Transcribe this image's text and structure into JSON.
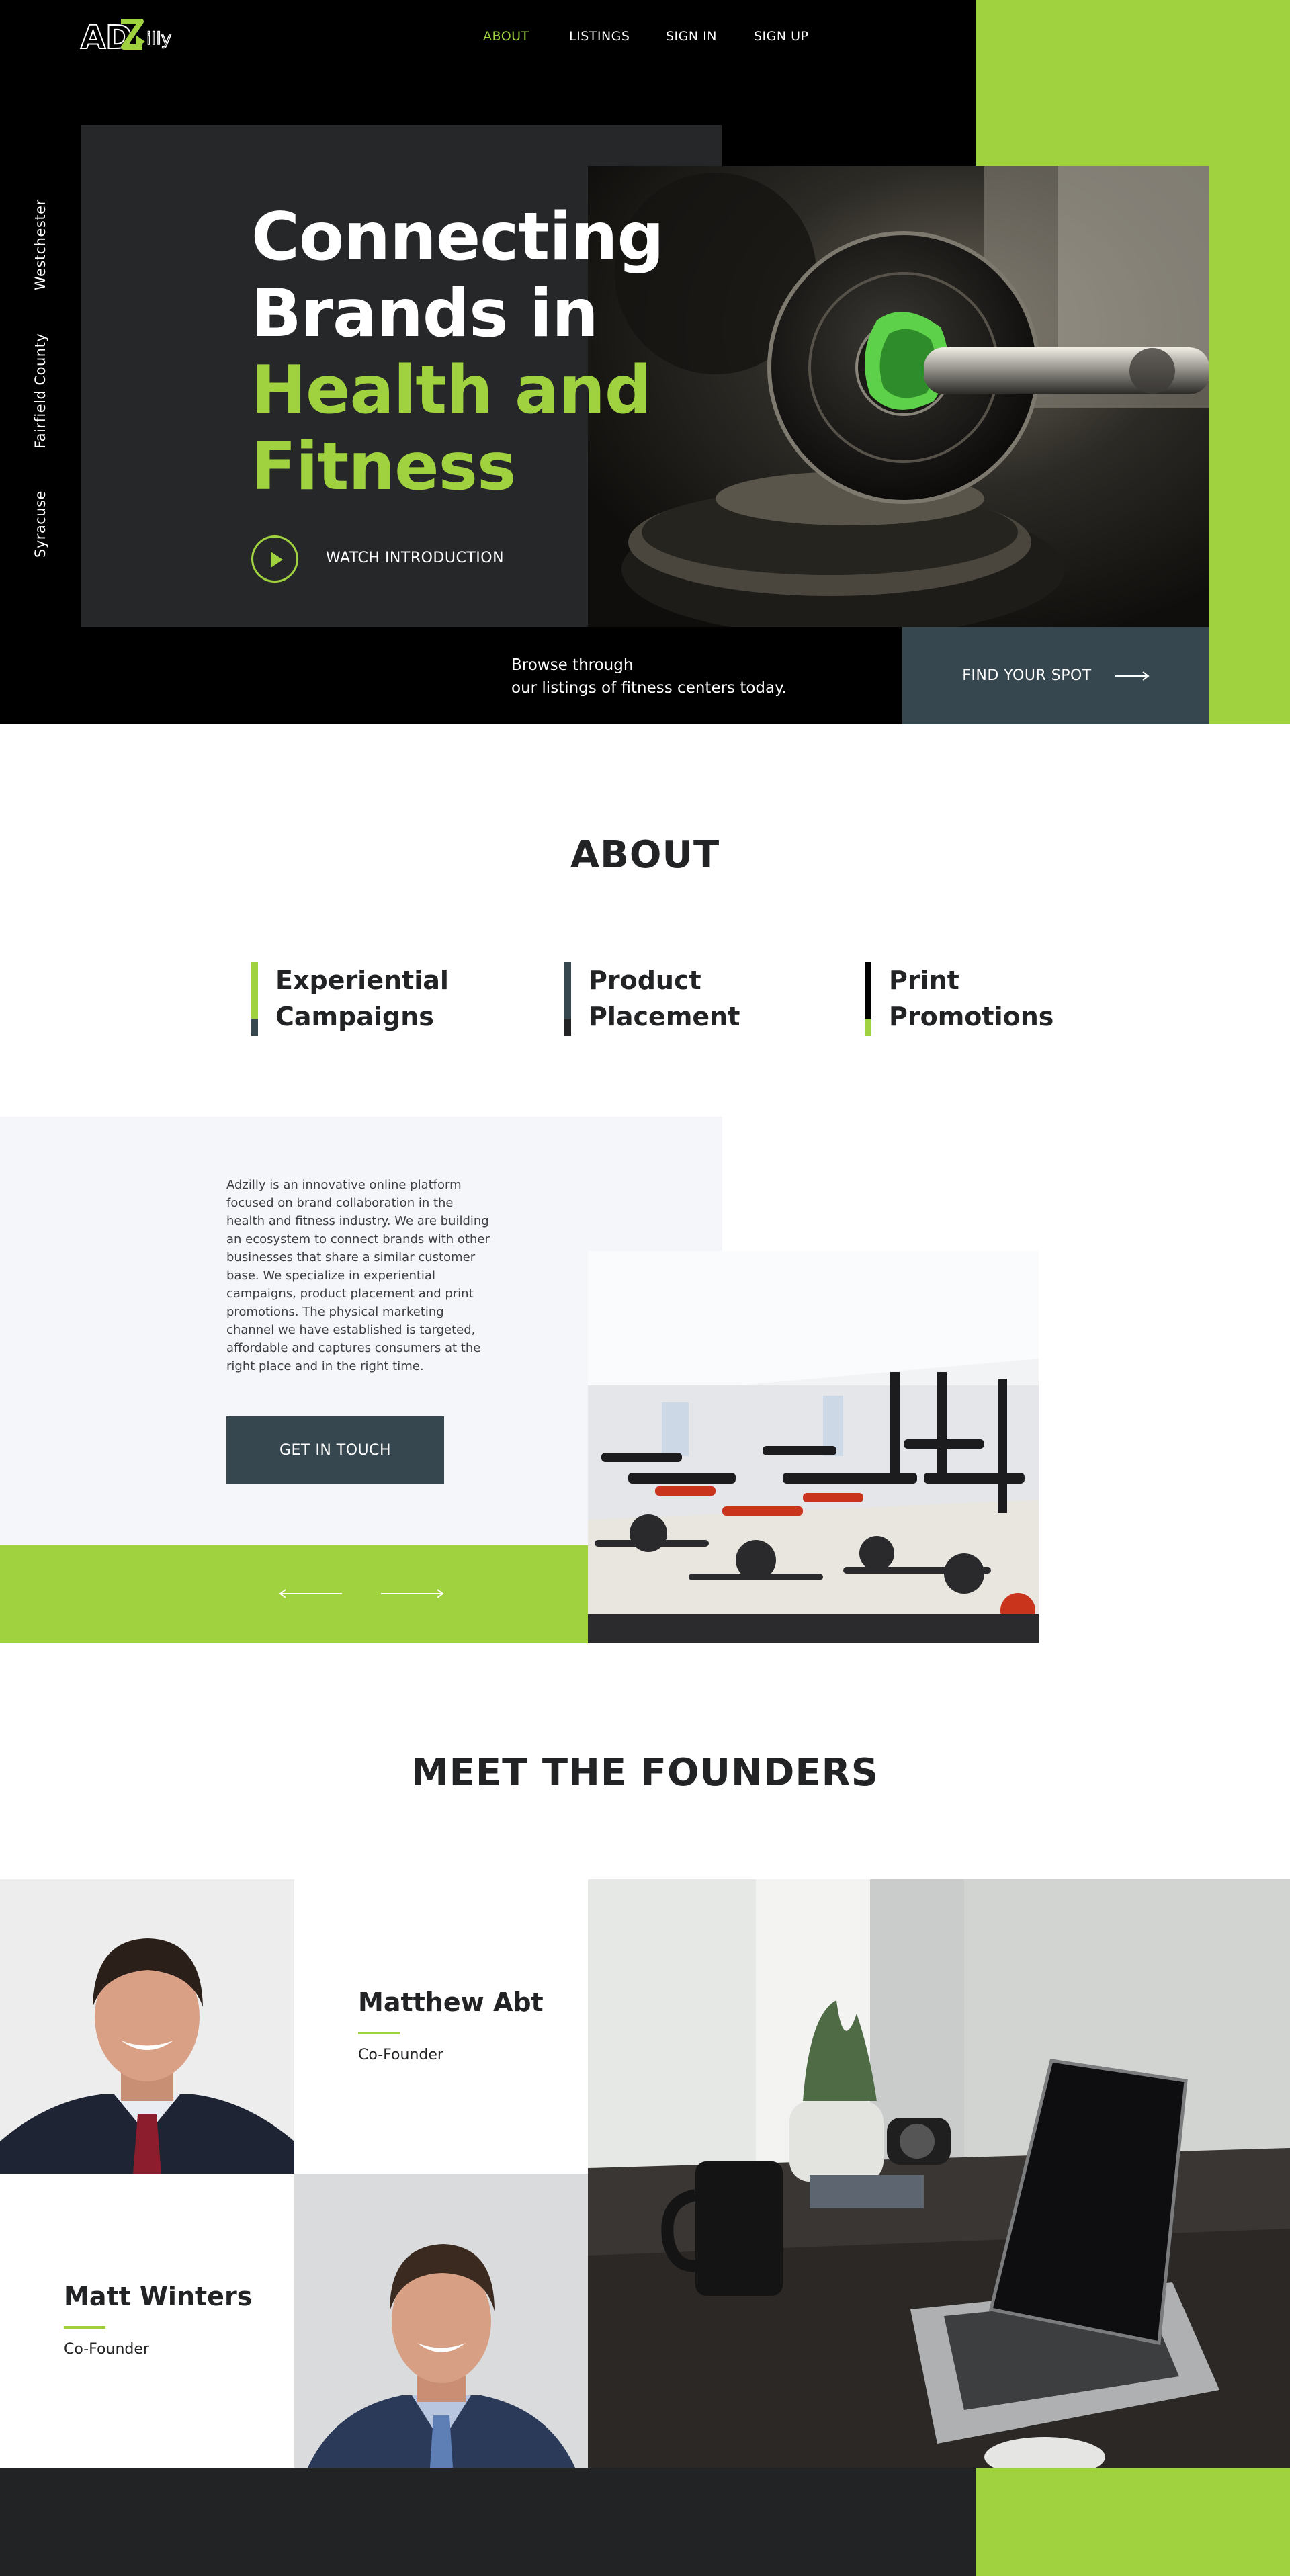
{
  "brand": {
    "logo_text": "ADZilly",
    "colors": {
      "accent": "#a0d23f",
      "dark": "#000000",
      "slate": "#37474f",
      "panel": "#262729",
      "text": "#222325"
    }
  },
  "nav": [
    {
      "label": "ABOUT",
      "active": true
    },
    {
      "label": "LISTINGS",
      "active": false
    },
    {
      "label": "SIGN IN",
      "active": false
    },
    {
      "label": "SIGN UP",
      "active": false
    }
  ],
  "hero": {
    "side_locations": [
      "Westchester",
      "Fairfield County",
      "Syracuse"
    ],
    "headline_white_1": "Connecting",
    "headline_white_2": "Brands in",
    "headline_green_1": "Health and",
    "headline_green_2": "Fitness",
    "watch_label": "WATCH INTRODUCTION",
    "browse_line_1": "Browse through",
    "browse_line_2": "our listings of fitness centers today.",
    "cta_label": "FIND YOUR SPOT",
    "icons": {
      "play": "play-icon",
      "arrow": "arrow-right-icon"
    }
  },
  "about": {
    "title": "ABOUT",
    "services": [
      {
        "line1": "Experiential",
        "line2": "Campaigns"
      },
      {
        "line1": "Product",
        "line2": "Placement"
      },
      {
        "line1": "Print",
        "line2": "Promotions"
      }
    ],
    "body": "Adzilly is an innovative online platform focused on brand collaboration in the health and fitness industry. We are building an ecosystem to connect brands with other businesses that share a similar customer base. We specialize in experiential campaigns, product placement and print promotions. The physical marketing channel we have established is targeted, affordable and captures consumers at the right place and in the right time.",
    "cta_label": "GET IN TOUCH",
    "icons": {
      "prev": "arrow-left-icon",
      "next": "arrow-right-icon"
    }
  },
  "founders": {
    "title": "MEET THE FOUNDERS",
    "people": [
      {
        "name": "Matthew Abt",
        "role": "Co-Founder"
      },
      {
        "name": "Matt Winters",
        "role": "Co-Founder"
      }
    ]
  }
}
